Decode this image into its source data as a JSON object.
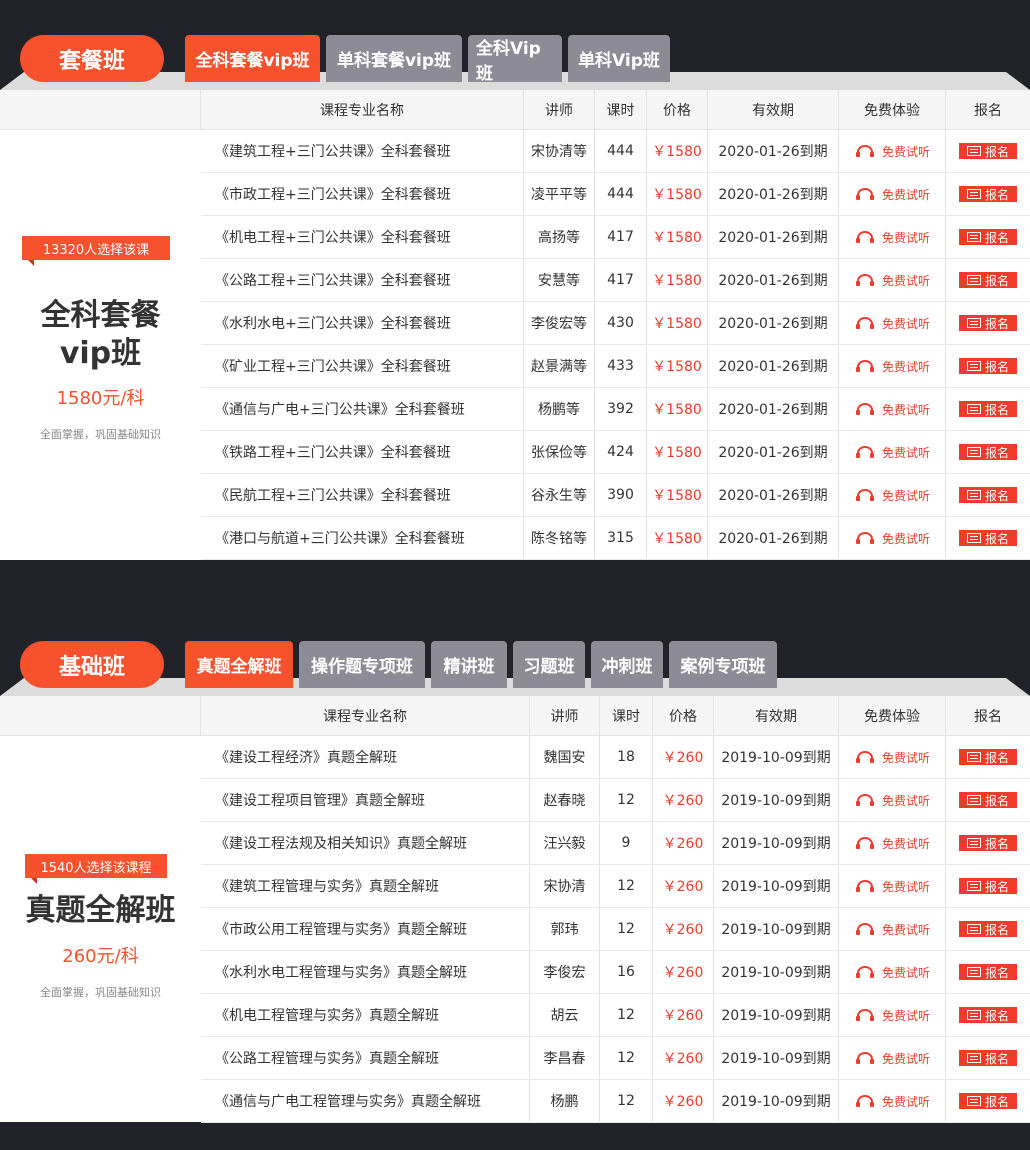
{
  "headers": [
    "课程专业名称",
    "讲师",
    "课时",
    "价格",
    "有效期",
    "免费体验",
    "报名"
  ],
  "colors": {
    "accent": "#f7512d",
    "tab_inactive": "#8d8c96",
    "price": "#ef3b2c",
    "background": "#222328"
  },
  "icons": {
    "trial": "headphones-icon",
    "signup": "grid-icon"
  },
  "package": {
    "pill": "套餐班",
    "tabs": [
      "全科套餐vip班",
      "单科套餐vip班",
      "全科Vip班",
      "单科Vip班"
    ],
    "active_tab": 0,
    "badge": "13320人选择该课",
    "title_line1": "全科套餐",
    "title_line2": "vip班",
    "price": "1580元/科",
    "desc": "全面掌握，巩固基础知识",
    "rows": [
      {
        "name": "《建筑工程+三门公共课》全科套餐班",
        "teacher": "宋协清等",
        "hours": "444",
        "price": "￥1580",
        "valid": "2020-01-26到期",
        "trial": "免费试听",
        "signup": "报名"
      },
      {
        "name": "《市政工程+三门公共课》全科套餐班",
        "teacher": "凌平平等",
        "hours": "444",
        "price": "￥1580",
        "valid": "2020-01-26到期",
        "trial": "免费试听",
        "signup": "报名"
      },
      {
        "name": "《机电工程+三门公共课》全科套餐班",
        "teacher": "高扬等",
        "hours": "417",
        "price": "￥1580",
        "valid": "2020-01-26到期",
        "trial": "免费试听",
        "signup": "报名"
      },
      {
        "name": "《公路工程+三门公共课》全科套餐班",
        "teacher": "安慧等",
        "hours": "417",
        "price": "￥1580",
        "valid": "2020-01-26到期",
        "trial": "免费试听",
        "signup": "报名"
      },
      {
        "name": "《水利水电+三门公共课》全科套餐班",
        "teacher": "李俊宏等",
        "hours": "430",
        "price": "￥1580",
        "valid": "2020-01-26到期",
        "trial": "免费试听",
        "signup": "报名"
      },
      {
        "name": "《矿业工程+三门公共课》全科套餐班",
        "teacher": "赵景满等",
        "hours": "433",
        "price": "￥1580",
        "valid": "2020-01-26到期",
        "trial": "免费试听",
        "signup": "报名"
      },
      {
        "name": "《通信与广电+三门公共课》全科套餐班",
        "teacher": "杨鹏等",
        "hours": "392",
        "price": "￥1580",
        "valid": "2020-01-26到期",
        "trial": "免费试听",
        "signup": "报名"
      },
      {
        "name": "《铁路工程+三门公共课》全科套餐班",
        "teacher": "张保俭等",
        "hours": "424",
        "price": "￥1580",
        "valid": "2020-01-26到期",
        "trial": "免费试听",
        "signup": "报名"
      },
      {
        "name": "《民航工程+三门公共课》全科套餐班",
        "teacher": "谷永生等",
        "hours": "390",
        "price": "￥1580",
        "valid": "2020-01-26到期",
        "trial": "免费试听",
        "signup": "报名"
      },
      {
        "name": "《港口与航道+三门公共课》全科套餐班",
        "teacher": "陈冬铭等",
        "hours": "315",
        "price": "￥1580",
        "valid": "2020-01-26到期",
        "trial": "免费试听",
        "signup": "报名"
      }
    ]
  },
  "basic": {
    "pill": "基础班",
    "tabs": [
      "真题全解班",
      "操作题专项班",
      "精讲班",
      "习题班",
      "冲刺班",
      "案例专项班"
    ],
    "active_tab": 0,
    "badge": "1540人选择该课程",
    "title_line1": "真题全解班",
    "price": "260元/科",
    "desc": "全面掌握，巩固基础知识",
    "rows": [
      {
        "name": "《建设工程经济》真题全解班",
        "teacher": "魏国安",
        "hours": "18",
        "price": "￥260",
        "valid": "2019-10-09到期",
        "trial": "免费试听",
        "signup": "报名"
      },
      {
        "name": "《建设工程项目管理》真题全解班",
        "teacher": "赵春晓",
        "hours": "12",
        "price": "￥260",
        "valid": "2019-10-09到期",
        "trial": "免费试听",
        "signup": "报名"
      },
      {
        "name": "《建设工程法规及相关知识》真题全解班",
        "teacher": "汪兴毅",
        "hours": "9",
        "price": "￥260",
        "valid": "2019-10-09到期",
        "trial": "免费试听",
        "signup": "报名"
      },
      {
        "name": "《建筑工程管理与实务》真题全解班",
        "teacher": "宋协清",
        "hours": "12",
        "price": "￥260",
        "valid": "2019-10-09到期",
        "trial": "免费试听",
        "signup": "报名"
      },
      {
        "name": "《市政公用工程管理与实务》真题全解班",
        "teacher": "郭玮",
        "hours": "12",
        "price": "￥260",
        "valid": "2019-10-09到期",
        "trial": "免费试听",
        "signup": "报名"
      },
      {
        "name": "《水利水电工程管理与实务》真题全解班",
        "teacher": "李俊宏",
        "hours": "16",
        "price": "￥260",
        "valid": "2019-10-09到期",
        "trial": "免费试听",
        "signup": "报名"
      },
      {
        "name": "《机电工程管理与实务》真题全解班",
        "teacher": "胡云",
        "hours": "12",
        "price": "￥260",
        "valid": "2019-10-09到期",
        "trial": "免费试听",
        "signup": "报名"
      },
      {
        "name": "《公路工程管理与实务》真题全解班",
        "teacher": "李昌春",
        "hours": "12",
        "price": "￥260",
        "valid": "2019-10-09到期",
        "trial": "免费试听",
        "signup": "报名"
      },
      {
        "name": "《通信与广电工程管理与实务》真题全解班",
        "teacher": "杨鹏",
        "hours": "12",
        "price": "￥260",
        "valid": "2019-10-09到期",
        "trial": "免费试听",
        "signup": "报名"
      }
    ]
  }
}
